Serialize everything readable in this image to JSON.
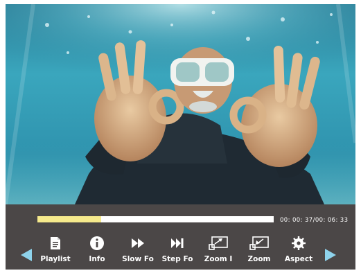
{
  "player": {
    "progress_fraction": 0.27,
    "time_display": "00: 00: 37/00: 06: 33"
  },
  "toolbar": {
    "prev_icon": "triangle-left-icon",
    "next_icon": "triangle-right-icon",
    "buttons": [
      {
        "label": "Playlist",
        "icon": "playlist-icon"
      },
      {
        "label": "Info",
        "icon": "info-icon"
      },
      {
        "label": "Slow Fo",
        "icon": "slow-forward-icon"
      },
      {
        "label": "Step Fo",
        "icon": "step-forward-icon"
      },
      {
        "label": "Zoom I",
        "icon": "zoom-in-icon"
      },
      {
        "label": "Zoom",
        "icon": "zoom-icon"
      },
      {
        "label": "Aspect",
        "icon": "aspect-gear-icon"
      }
    ]
  },
  "colors": {
    "control_bar": "#4b4747",
    "progress_fill": "#f6ea8c",
    "progress_track": "#ffffff",
    "nav_arrow": "#8ed3ec",
    "text": "#ffffff"
  }
}
